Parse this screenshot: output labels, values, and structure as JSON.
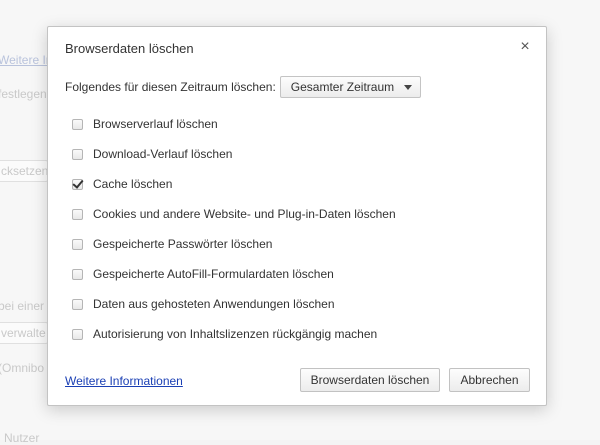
{
  "background": {
    "link_more": "Weitere In",
    "text_define": "festlegen",
    "field_reset": "cksetzen",
    "text_at_one": "bei einer",
    "field_manage": "verwalte",
    "text_omnibox": "(Omnibo",
    "text_users": "Nutzer"
  },
  "dialog": {
    "title": "Browserdaten löschen",
    "close_glyph": "×",
    "period_label": "Folgendes für diesen Zeitraum löschen:",
    "period_selected": "Gesamter Zeitraum",
    "options": [
      {
        "label": "Browserverlauf löschen",
        "checked": false
      },
      {
        "label": "Download-Verlauf löschen",
        "checked": false
      },
      {
        "label": "Cache löschen",
        "checked": true
      },
      {
        "label": "Cookies und andere Website- und Plug-in-Daten löschen",
        "checked": false
      },
      {
        "label": "Gespeicherte Passwörter löschen",
        "checked": false
      },
      {
        "label": "Gespeicherte AutoFill-Formulardaten löschen",
        "checked": false
      },
      {
        "label": "Daten aus gehosteten Anwendungen löschen",
        "checked": false
      },
      {
        "label": "Autorisierung von Inhaltslizenzen rückgängig machen",
        "checked": false
      }
    ],
    "more_info_link": "Weitere Informationen",
    "clear_button": "Browserdaten löschen",
    "cancel_button": "Abbrechen"
  }
}
